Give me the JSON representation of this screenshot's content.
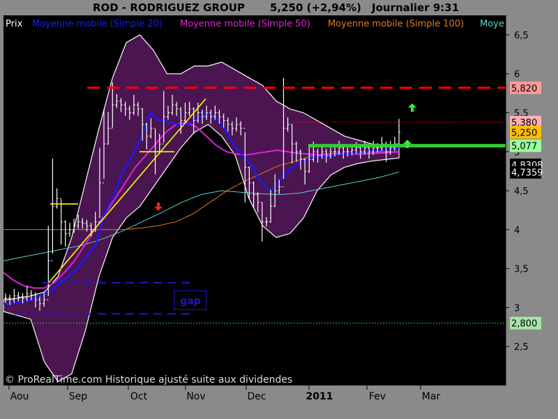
{
  "header": {
    "ticker_name": "ROD - RODRIGUEZ GROUP",
    "price_change": "5,250 (+2,94%)",
    "period_time": "Journalier  9:31"
  },
  "footer": {
    "copyright": "© ProRealTime.com Historique ajusté suite aux dividendes"
  },
  "colors": {
    "background": "#000000",
    "frame": "#8a8a8a",
    "bollinger_fill": "#4a1550",
    "price_bar": "#ffffff",
    "sma20": "#1a1aff",
    "sma50": "#e020e0",
    "sma100": "#e07a20",
    "sma200": "#60d0d0",
    "trendline": "#ffff00",
    "resistance": "#ff0000",
    "support": "#33cc33",
    "gap": "#1a1acc"
  },
  "chart_data": {
    "type": "line",
    "title": "ROD - RODRIGUEZ GROUP",
    "xlabel": "",
    "ylabel": "",
    "ylim": [
      2.0,
      6.75
    ],
    "y_ticks": [
      2.5,
      3,
      3.5,
      4,
      4.5,
      5,
      5.5,
      6,
      6.5
    ],
    "y_tick_labels": [
      "2,5",
      "3",
      "3,5",
      "4",
      "4,5",
      "5",
      "5,5",
      "6",
      "6,5"
    ],
    "x_months": [
      {
        "label": "Aou",
        "bold": false
      },
      {
        "label": "Sep",
        "bold": false
      },
      {
        "label": "Oct",
        "bold": false
      },
      {
        "label": "Nov",
        "bold": false
      },
      {
        "label": "Dec",
        "bold": false
      },
      {
        "label": "2011",
        "bold": true
      },
      {
        "label": "Fev",
        "bold": false
      },
      {
        "label": "Mar",
        "bold": false
      }
    ],
    "legend": [
      "Prix",
      "Moyenne mobile (Simple 20)",
      "Moyenne mobile (Simple 50)",
      "Moyenne mobile (Simple 100)",
      "Moyenne mobile (Simple 200)"
    ],
    "legend_display": [
      "Prix",
      "Moyenne mobile (Simple 20)",
      "Moyenne mobile (Simple 50)",
      "Moyenne mobile (Simple 100)",
      "Moye"
    ],
    "series": [
      {
        "name": "Prix",
        "type": "bars",
        "values": [
          3.12,
          3.1,
          3.15,
          3.14,
          3.12,
          3.18,
          3.16,
          3.1,
          3.05,
          3.1,
          3.6,
          4.3,
          4.4,
          4.1,
          3.95,
          4.0,
          4.05,
          4.1,
          4.08,
          4.05,
          4.0,
          4.1,
          4.6,
          5.1,
          5.3,
          5.6,
          5.65,
          5.6,
          5.55,
          5.5,
          5.6,
          5.55,
          5.35,
          5.2,
          5.3,
          5.0,
          5.1,
          5.45,
          5.5,
          5.6,
          5.55,
          5.4,
          5.5,
          5.55,
          5.4,
          5.5,
          5.45,
          5.5,
          5.45,
          5.5,
          5.45,
          5.4,
          5.35,
          5.3,
          5.35,
          5.3,
          4.8,
          4.6,
          4.45,
          4.35,
          4.1,
          4.1,
          4.3,
          4.5,
          4.55,
          5.3,
          5.35,
          5.1,
          5.0,
          4.9,
          4.75,
          4.9,
          5.0,
          4.95,
          5.0,
          4.95,
          5.0,
          5.0,
          5.05,
          5.0,
          5.0,
          5.02,
          5.05,
          5.0,
          5.05,
          5.0,
          5.05,
          5.05,
          5.1,
          5.0,
          5.05,
          5.1,
          5.25
        ]
      },
      {
        "name": "Moyenne mobile (Simple 20)",
        "values": [
          3.05,
          3.05,
          3.08,
          3.1,
          3.15,
          3.2,
          3.3,
          3.4,
          3.5,
          3.65,
          3.8,
          4.2,
          4.45,
          4.75,
          4.95,
          5.2,
          5.5,
          5.4,
          5.38,
          5.35,
          5.35,
          5.42,
          5.48,
          5.45,
          5.3,
          5.1,
          4.95,
          4.82,
          4.6,
          4.5,
          4.62,
          4.75,
          4.85,
          4.9,
          4.95,
          4.93,
          4.95,
          4.97,
          4.98,
          5.0,
          5.0,
          5.02,
          5.03,
          5.05
        ]
      },
      {
        "name": "Moyenne mobile (Simple 50)",
        "values": [
          3.45,
          3.35,
          3.28,
          3.25,
          3.25,
          3.32,
          3.45,
          3.6,
          3.8,
          4.0,
          4.2,
          4.4,
          4.6,
          4.8,
          4.95,
          5.1,
          5.25,
          5.35,
          5.38,
          5.32,
          5.2,
          5.08,
          5.0,
          4.97,
          4.96,
          4.98,
          5.0,
          5.02,
          5.0,
          4.98,
          4.97,
          4.96,
          4.97,
          4.98,
          4.97,
          4.97,
          4.98,
          4.98,
          4.99,
          5.0
        ]
      },
      {
        "name": "Moyenne mobile (Simple 100)",
        "values": [
          4.0,
          4.0,
          4.0,
          4.0,
          4.0,
          4.0,
          4.0,
          4.0,
          4.02,
          4.05,
          4.1,
          4.2,
          4.35,
          4.5,
          4.62,
          4.72,
          4.82,
          4.88,
          4.95,
          4.97,
          4.98,
          4.99,
          5.0,
          5.0
        ]
      },
      {
        "name": "Moyenne mobile (Simple 200)",
        "values": [
          3.6,
          3.65,
          3.7,
          3.75,
          3.8,
          3.88,
          3.98,
          4.1,
          4.22,
          4.35,
          4.45,
          4.5,
          4.48,
          4.46,
          4.45,
          4.47,
          4.52,
          4.57,
          4.62,
          4.67,
          4.74
        ]
      }
    ],
    "bollinger_bands": {
      "upper": [
        3.1,
        3.12,
        3.15,
        3.2,
        3.4,
        3.9,
        4.6,
        5.3,
        5.95,
        6.4,
        6.5,
        6.3,
        6.0,
        6.0,
        6.1,
        6.1,
        6.15,
        6.05,
        5.95,
        5.85,
        5.65,
        5.55,
        5.5,
        5.4,
        5.3,
        5.2,
        5.15,
        5.1,
        5.08,
        5.1
      ],
      "lower": [
        2.95,
        2.9,
        2.85,
        2.3,
        2.05,
        2.15,
        2.7,
        3.4,
        3.9,
        4.15,
        4.3,
        4.55,
        4.8,
        5.05,
        5.25,
        5.35,
        5.2,
        4.95,
        4.4,
        4.05,
        3.9,
        3.95,
        4.15,
        4.5,
        4.7,
        4.8,
        4.85,
        4.88,
        4.9,
        4.92
      ]
    },
    "price_labels": [
      {
        "text": "5,820",
        "value": 5.82
      },
      {
        "text": "5,380",
        "value": 5.38
      },
      {
        "text": "5,250",
        "value": 5.25
      },
      {
        "text": "5,077",
        "value": 5.077
      },
      {
        "text": "4,8308",
        "value": 4.8308
      },
      {
        "text": "4,7359",
        "value": 4.7359
      },
      {
        "text": "2,800",
        "value": 2.8
      }
    ],
    "horizontal_lines": [
      {
        "name": "resistance",
        "value": 5.82,
        "style": "dashed"
      },
      {
        "name": "resistance-2",
        "value": 5.38,
        "style": "dotted"
      },
      {
        "name": "support",
        "value": 5.077,
        "style": "solid"
      },
      {
        "name": "low-level",
        "value": 2.8,
        "style": "dotted"
      },
      {
        "name": "gap-top",
        "value": 3.32,
        "style": "dashed"
      },
      {
        "name": "gap-bottom",
        "value": 2.92,
        "style": "dashed"
      }
    ],
    "annotations": [
      {
        "text": "gap",
        "value": 3.1
      }
    ]
  }
}
